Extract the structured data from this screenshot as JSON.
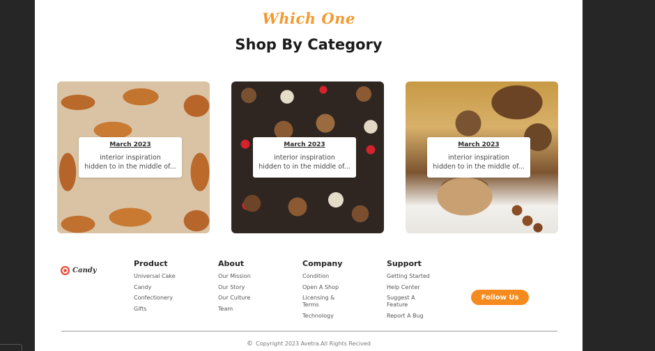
{
  "section": {
    "eyebrow": "Which One",
    "title": "Shop By Category"
  },
  "cards": [
    {
      "date": "March 2023",
      "desc_line1": "interior inspiration",
      "desc_line2": "hidden to in the middle of...",
      "image_icon": "croissants-image"
    },
    {
      "date": "March 2023",
      "desc_line1": "interior inspiration",
      "desc_line2": "hidden to in the middle of...",
      "image_icon": "cupcakes-image"
    },
    {
      "date": "March 2023",
      "desc_line1": "interior inspiration",
      "desc_line2": "hidden to in the middle of...",
      "image_icon": "chocolate-cupcake-image"
    }
  ],
  "footer": {
    "logo_text": "Candy",
    "columns": [
      {
        "title": "Product",
        "links": [
          "Universal Cake",
          "Candy",
          "Confectionery",
          "Gifts"
        ]
      },
      {
        "title": "About",
        "links": [
          "Our Mission",
          "Our Story",
          "Our Culture",
          "Team"
        ]
      },
      {
        "title": "Company",
        "links": [
          "Condition",
          "Open A Shop",
          "Licensing &",
          "Terms",
          "Technology"
        ]
      },
      {
        "title": "Support",
        "links": [
          "Getting Started",
          "Help Center",
          "Suggest A",
          "Feature",
          "Report A Bug"
        ]
      }
    ],
    "follow_label": "Follow Us",
    "copyright": "Copyright 2023 Avetra.All Rights Recived"
  },
  "colors": {
    "accent": "#f58a1f",
    "eyebrow": "#f39a2f"
  }
}
